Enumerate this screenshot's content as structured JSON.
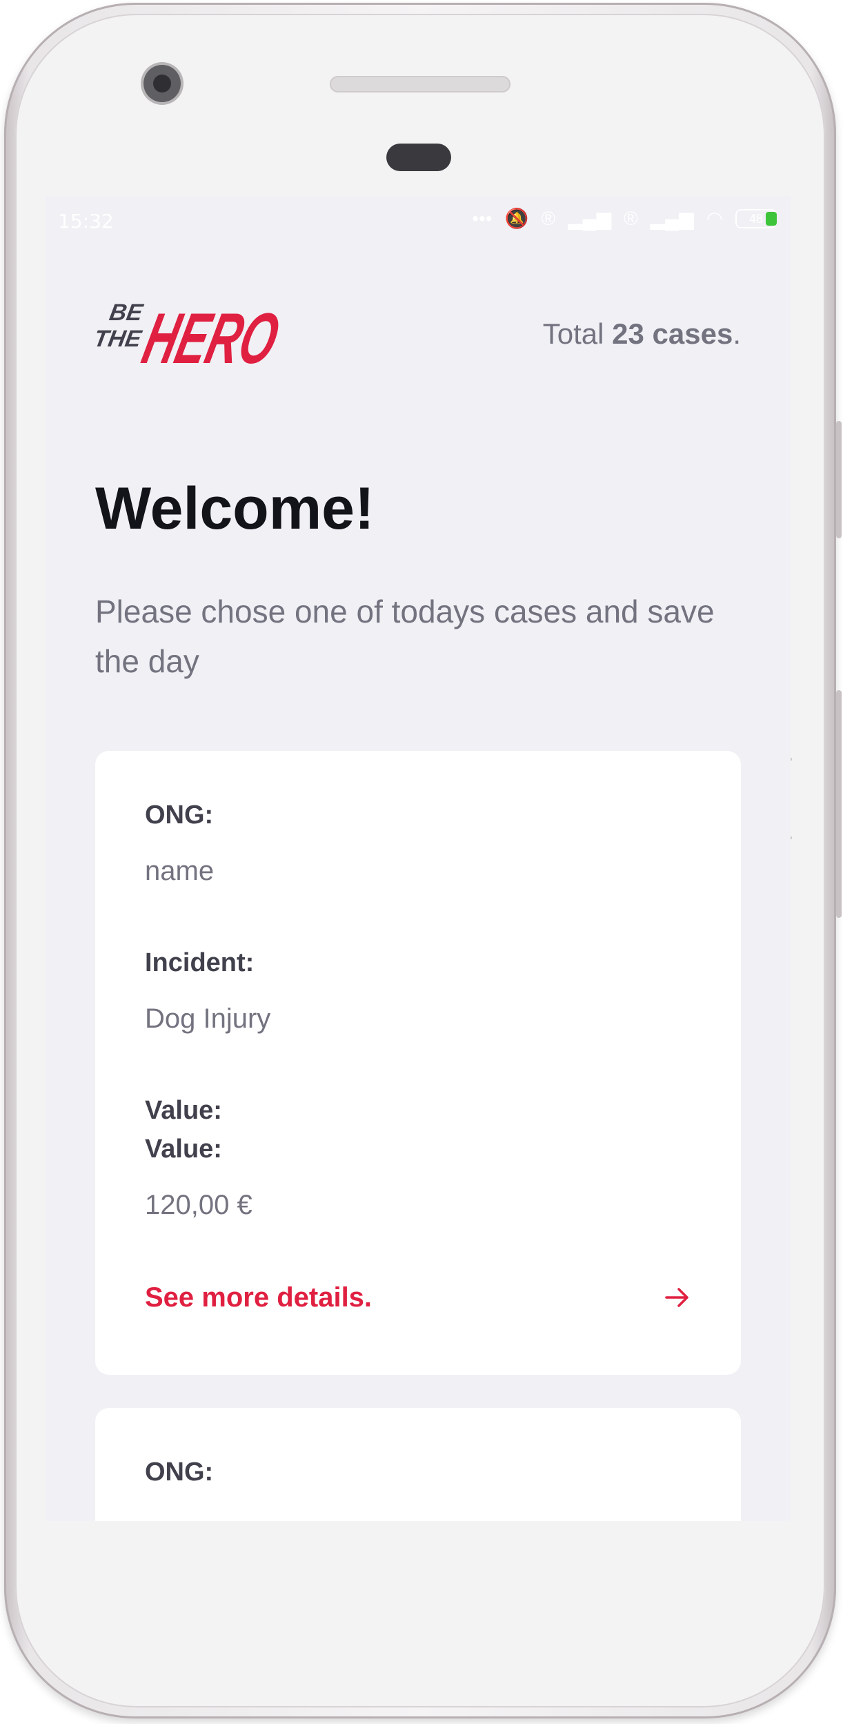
{
  "status_bar": {
    "time": "15:32",
    "battery": "48"
  },
  "header": {
    "logo_text_small": [
      "BE",
      "THE"
    ],
    "logo_text_big": "HERO",
    "total_prefix": "Total ",
    "total_count": "23 cases",
    "total_suffix": "."
  },
  "welcome": {
    "title": "Welcome!",
    "subtitle": "Please chose one of todays cases and save the day"
  },
  "cards": [
    {
      "ong_label": "ONG:",
      "ong_value": "name",
      "incident_label": "Incident:",
      "incident_value": "Dog Injury",
      "value_label_1": "Value:",
      "value_label_2": "Value:",
      "value_value": "120,00 €",
      "details_label": "See more details."
    },
    {
      "ong_label": "ONG:"
    }
  ],
  "colors": {
    "brand_red": "#e02041",
    "background": "#f0f0f5",
    "title": "#13131a",
    "muted": "#737380"
  }
}
